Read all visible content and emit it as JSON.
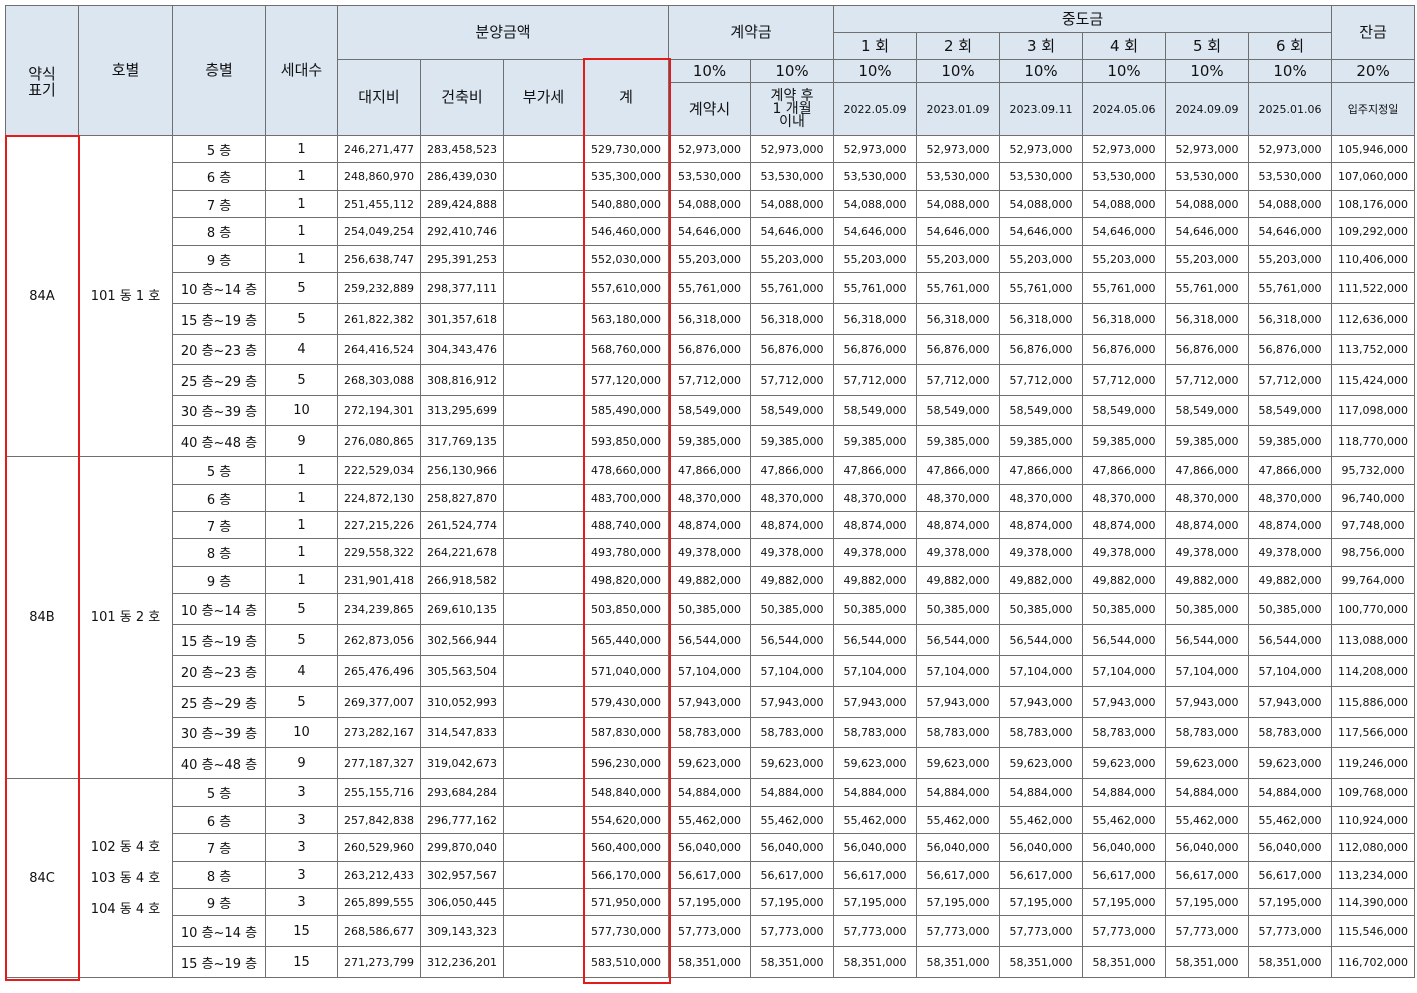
{
  "header": {
    "type_label": "약식\n표기",
    "unit_label": "호별",
    "floor_label": "층별",
    "households_label": "세대수",
    "sale_price_label": "분양금액",
    "land_label": "대지비",
    "building_label": "건축비",
    "vat_label": "부가세",
    "total_label": "계",
    "deposit_label": "계약금",
    "middle_label": "중도금",
    "balance_label": "잔금",
    "middle_rounds": [
      "1 회",
      "2 회",
      "3 회",
      "4 회",
      "5 회",
      "6 회"
    ],
    "dep1_pct": "10%",
    "dep2_pct": "10%",
    "middle_pct": [
      "10%",
      "10%",
      "10%",
      "10%",
      "10%",
      "10%"
    ],
    "balance_pct": "20%",
    "dep1_when": "계약시",
    "dep2_when": "계약 후\n1 개월\n이내",
    "middle_dates": [
      "2022.05.09",
      "2023.01.09",
      "2023.09.11",
      "2024.05.06",
      "2024.09.09",
      "2025.01.06"
    ],
    "balance_when": "입주지정일"
  },
  "groups": [
    {
      "type": "84A",
      "units": [
        "101 동 1 호"
      ],
      "rows": [
        {
          "floor": "5 층",
          "hh": "1",
          "land": "246,271,477",
          "build": "283,458,523",
          "total": "529,730,000",
          "inst": "52,973,000",
          "bal": "105,946,000"
        },
        {
          "floor": "6 층",
          "hh": "1",
          "land": "248,860,970",
          "build": "286,439,030",
          "total": "535,300,000",
          "inst": "53,530,000",
          "bal": "107,060,000"
        },
        {
          "floor": "7 층",
          "hh": "1",
          "land": "251,455,112",
          "build": "289,424,888",
          "total": "540,880,000",
          "inst": "54,088,000",
          "bal": "108,176,000"
        },
        {
          "floor": "8 층",
          "hh": "1",
          "land": "254,049,254",
          "build": "292,410,746",
          "total": "546,460,000",
          "inst": "54,646,000",
          "bal": "109,292,000"
        },
        {
          "floor": "9 층",
          "hh": "1",
          "land": "256,638,747",
          "build": "295,391,253",
          "total": "552,030,000",
          "inst": "55,203,000",
          "bal": "110,406,000"
        },
        {
          "floor": "10 층~14 층",
          "hh": "5",
          "land": "259,232,889",
          "build": "298,377,111",
          "total": "557,610,000",
          "inst": "55,761,000",
          "bal": "111,522,000"
        },
        {
          "floor": "15 층~19 층",
          "hh": "5",
          "land": "261,822,382",
          "build": "301,357,618",
          "total": "563,180,000",
          "inst": "56,318,000",
          "bal": "112,636,000"
        },
        {
          "floor": "20 층~23 층",
          "hh": "4",
          "land": "264,416,524",
          "build": "304,343,476",
          "total": "568,760,000",
          "inst": "56,876,000",
          "bal": "113,752,000"
        },
        {
          "floor": "25 층~29 층",
          "hh": "5",
          "land": "268,303,088",
          "build": "308,816,912",
          "total": "577,120,000",
          "inst": "57,712,000",
          "bal": "115,424,000"
        },
        {
          "floor": "30 층~39 층",
          "hh": "10",
          "land": "272,194,301",
          "build": "313,295,699",
          "total": "585,490,000",
          "inst": "58,549,000",
          "bal": "117,098,000"
        },
        {
          "floor": "40 층~48 층",
          "hh": "9",
          "land": "276,080,865",
          "build": "317,769,135",
          "total": "593,850,000",
          "inst": "59,385,000",
          "bal": "118,770,000"
        }
      ]
    },
    {
      "type": "84B",
      "units": [
        "101 동 2 호"
      ],
      "rows": [
        {
          "floor": "5 층",
          "hh": "1",
          "land": "222,529,034",
          "build": "256,130,966",
          "total": "478,660,000",
          "inst": "47,866,000",
          "bal": "95,732,000"
        },
        {
          "floor": "6 층",
          "hh": "1",
          "land": "224,872,130",
          "build": "258,827,870",
          "total": "483,700,000",
          "inst": "48,370,000",
          "bal": "96,740,000"
        },
        {
          "floor": "7 층",
          "hh": "1",
          "land": "227,215,226",
          "build": "261,524,774",
          "total": "488,740,000",
          "inst": "48,874,000",
          "bal": "97,748,000"
        },
        {
          "floor": "8 층",
          "hh": "1",
          "land": "229,558,322",
          "build": "264,221,678",
          "total": "493,780,000",
          "inst": "49,378,000",
          "bal": "98,756,000"
        },
        {
          "floor": "9 층",
          "hh": "1",
          "land": "231,901,418",
          "build": "266,918,582",
          "total": "498,820,000",
          "inst": "49,882,000",
          "bal": "99,764,000"
        },
        {
          "floor": "10 층~14 층",
          "hh": "5",
          "land": "234,239,865",
          "build": "269,610,135",
          "total": "503,850,000",
          "inst": "50,385,000",
          "bal": "100,770,000"
        },
        {
          "floor": "15 층~19 층",
          "hh": "5",
          "land": "262,873,056",
          "build": "302,566,944",
          "total": "565,440,000",
          "inst": "56,544,000",
          "bal": "113,088,000"
        },
        {
          "floor": "20 층~23 층",
          "hh": "4",
          "land": "265,476,496",
          "build": "305,563,504",
          "total": "571,040,000",
          "inst": "57,104,000",
          "bal": "114,208,000"
        },
        {
          "floor": "25 층~29 층",
          "hh": "5",
          "land": "269,377,007",
          "build": "310,052,993",
          "total": "579,430,000",
          "inst": "57,943,000",
          "bal": "115,886,000"
        },
        {
          "floor": "30 층~39 층",
          "hh": "10",
          "land": "273,282,167",
          "build": "314,547,833",
          "total": "587,830,000",
          "inst": "58,783,000",
          "bal": "117,566,000"
        },
        {
          "floor": "40 층~48 층",
          "hh": "9",
          "land": "277,187,327",
          "build": "319,042,673",
          "total": "596,230,000",
          "inst": "59,623,000",
          "bal": "119,246,000"
        }
      ]
    },
    {
      "type": "84C",
      "units": [
        "102 동 4 호",
        "103 동 4 호",
        "104 동 4 호"
      ],
      "rows": [
        {
          "floor": "5 층",
          "hh": "3",
          "land": "255,155,716",
          "build": "293,684,284",
          "total": "548,840,000",
          "inst": "54,884,000",
          "bal": "109,768,000"
        },
        {
          "floor": "6 층",
          "hh": "3",
          "land": "257,842,838",
          "build": "296,777,162",
          "total": "554,620,000",
          "inst": "55,462,000",
          "bal": "110,924,000"
        },
        {
          "floor": "7 층",
          "hh": "3",
          "land": "260,529,960",
          "build": "299,870,040",
          "total": "560,400,000",
          "inst": "56,040,000",
          "bal": "112,080,000"
        },
        {
          "floor": "8 층",
          "hh": "3",
          "land": "263,212,433",
          "build": "302,957,567",
          "total": "566,170,000",
          "inst": "56,617,000",
          "bal": "113,234,000"
        },
        {
          "floor": "9 층",
          "hh": "3",
          "land": "265,899,555",
          "build": "306,050,445",
          "total": "571,950,000",
          "inst": "57,195,000",
          "bal": "114,390,000"
        },
        {
          "floor": "10 층~14 층",
          "hh": "15",
          "land": "268,586,677",
          "build": "309,143,323",
          "total": "577,730,000",
          "inst": "57,773,000",
          "bal": "115,546,000"
        },
        {
          "floor": "15 층~19 층",
          "hh": "15",
          "land": "271,273,799",
          "build": "312,236,201",
          "total": "583,510,000",
          "inst": "58,351,000",
          "bal": "116,702,000"
        }
      ]
    }
  ],
  "highlight_color": "#e21b1b",
  "header_bg": "#dce6f1"
}
